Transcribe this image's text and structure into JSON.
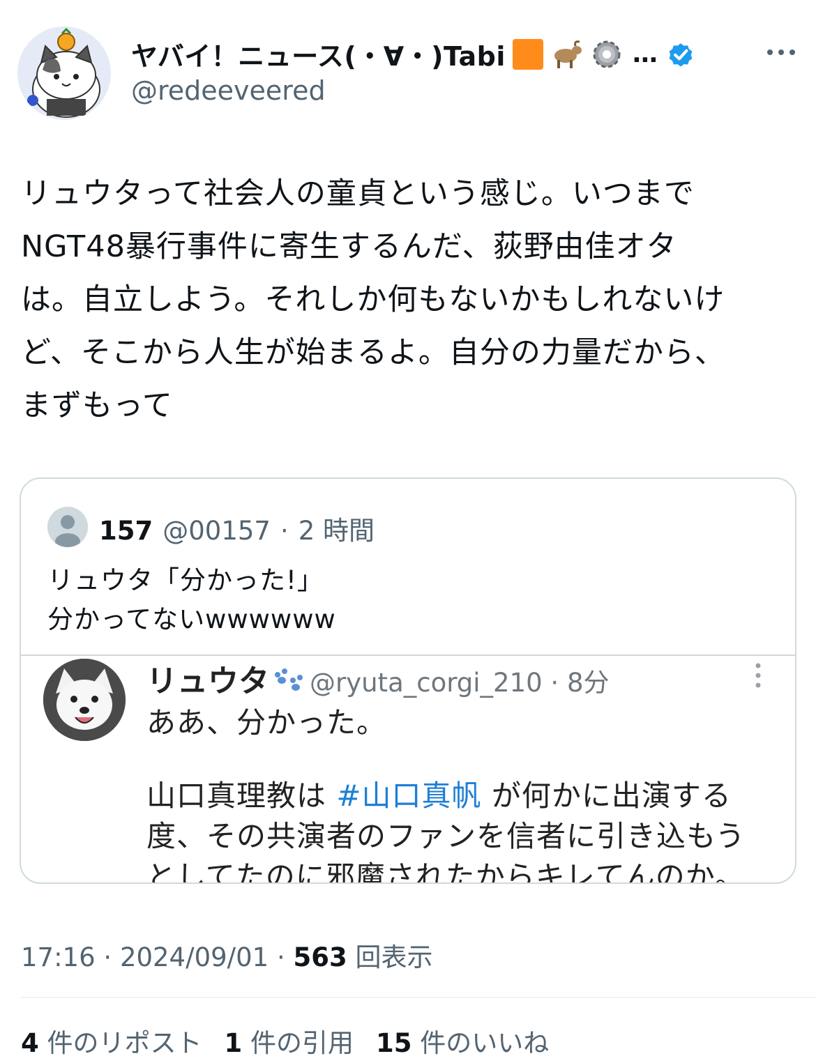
{
  "author": {
    "display_name": "ヤバイ！ニュース(・∀・)Tabi",
    "name_suffix": "…",
    "handle": "@redeeveered",
    "emoji_icons": [
      "orange-square-icon",
      "goat-icon",
      "gear-icon"
    ],
    "verified": true,
    "verified_color": "#1d9bf0"
  },
  "tweet": {
    "text": "リュウタって社会人の童貞という感じ。いつまで\nNGT48暴行事件に寄生するんだ、荻野由佳オタ\nは。自立しよう。それしか何もないかもしれないけ\nど、そこから人生が始まるよ。自分の力量だから、\nまずもって"
  },
  "quote": {
    "name": "157",
    "handle": "@00157",
    "sep": "·",
    "time": "2 時間",
    "text": "リュウタ「分かった!」\n分かってないwwwwww",
    "embedded": {
      "name": "リュウタ",
      "handle": "@ryuta_corgi_210 · 8分",
      "line1": "ああ、分かった。",
      "para_line1_pre": "山口真理教は ",
      "hashtag": "#山口真帆",
      "para_line1_post": " が何かに出演する",
      "para_line2": "度、その共演者のファンを信者に引き込もう",
      "para_line3": "としてたのに邪魔されたからキレてんのか。",
      "hashtag_color": "#1d7fd6"
    }
  },
  "meta": {
    "time": "17:16",
    "sep1": " · ",
    "date": "2024/09/01",
    "sep2": " · ",
    "views": "563",
    "views_label": " 回表示"
  },
  "stats": {
    "reposts_count": "4",
    "reposts_label": " 件のリポスト",
    "quotes_count": "1",
    "quotes_label": " 件の引用",
    "likes_count": "15",
    "likes_label": " 件のいいね"
  }
}
